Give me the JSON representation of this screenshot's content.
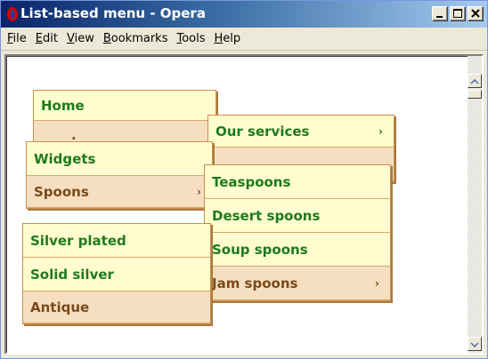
{
  "window": {
    "title": "List-based menu - Opera"
  },
  "menubar": {
    "items": [
      {
        "key": "F",
        "rest": "ile"
      },
      {
        "key": "E",
        "rest": "dit"
      },
      {
        "key": "V",
        "rest": "iew"
      },
      {
        "key": "B",
        "rest": "ookmarks"
      },
      {
        "key": "T",
        "rest": "ools"
      },
      {
        "key": "H",
        "rest": "elp"
      }
    ]
  },
  "menus": {
    "main": {
      "home": "Home",
      "partial": "."
    },
    "services": {
      "our_services": "Our services",
      "arrow": "›",
      "partial": "."
    },
    "products": {
      "widgets": "Widgets",
      "spoons": "Spoons",
      "arrow": "›"
    },
    "spoons": {
      "teaspoons": "Teaspoons",
      "desert": "Desert spoons",
      "soup": "Soup spoons",
      "jam": "Jam spoons",
      "arrow": "›"
    },
    "finish": {
      "silver_plated": "Silver plated",
      "solid_silver": "Solid silver",
      "antique": "Antique"
    }
  },
  "colors": {
    "item_light": "#fffccf",
    "item_dark": "#f5dfc0",
    "text_green": "#1e7a1e",
    "text_brown": "#7a4a1a",
    "border": "#c9904e"
  }
}
